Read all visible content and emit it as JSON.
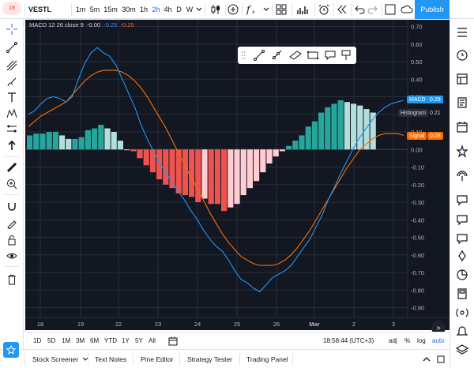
{
  "header": {
    "avatar_count": "18",
    "symbol": "VESTL",
    "intervals": [
      "1m",
      "5m",
      "15m",
      "30m",
      "1h",
      "2h",
      "4h",
      "D",
      "W"
    ],
    "active_interval": "2h",
    "publish_label": "Publish"
  },
  "chart": {
    "legend": {
      "name": "MACD 12 26 close 9",
      "histogram": "-0.00",
      "macd": "-0.25",
      "signal": "-0.25"
    },
    "tags": {
      "macd_name": "MACD",
      "macd_value": "0.28",
      "hist_name": "Histogram",
      "hist_value": "0.21",
      "signal_name": "Signal",
      "signal_value": "0.08"
    },
    "scroll_label": "»"
  },
  "chart_data": {
    "type": "line",
    "title": "MACD 12 26 close 9",
    "x_ticks": [
      "18",
      "19",
      "22",
      "23",
      "24",
      "25",
      "26",
      "Mar",
      "2",
      "3"
    ],
    "y_ticks": [
      "0.70",
      "0.60",
      "0.50",
      "0.40",
      "0.30",
      "0.20",
      "0.10",
      "0.00",
      "-0.10",
      "-0.20",
      "-0.30",
      "-0.40",
      "-0.50",
      "-0.60",
      "-0.70",
      "-0.80",
      "-0.90"
    ],
    "ylim": [
      -0.905,
      0.71
    ],
    "x_index_range": [
      0,
      60
    ],
    "colors": {
      "macd": "#2196f3",
      "signal": "#ff6d00",
      "hist_pos_strong": "#26a69a",
      "hist_pos_weak": "#b2dfdb",
      "hist_neg_strong": "#ef5350",
      "hist_neg_weak": "#ffcdd2",
      "grid": "#2a2e39",
      "axis_text": "#b2b5be"
    },
    "series": [
      {
        "name": "MACD",
        "x": [
          0,
          1,
          2,
          3,
          4,
          5,
          6,
          7,
          8,
          9,
          10,
          11,
          12,
          13,
          14,
          15,
          16,
          17,
          18,
          19,
          20,
          21,
          22,
          23,
          24,
          25,
          26,
          27,
          28,
          29,
          30,
          31,
          32,
          33,
          34,
          35,
          36,
          37,
          38,
          39,
          40,
          41,
          42,
          43,
          44,
          45,
          46,
          47,
          48,
          49,
          50,
          51,
          52,
          53,
          54,
          55,
          56,
          57,
          58,
          59,
          60
        ],
        "values": [
          0.2,
          0.22,
          0.26,
          0.29,
          0.3,
          0.29,
          0.27,
          0.3,
          0.4,
          0.49,
          0.55,
          0.58,
          0.55,
          0.53,
          0.48,
          0.4,
          0.32,
          0.24,
          0.14,
          0.06,
          -0.01,
          -0.08,
          -0.13,
          -0.19,
          -0.24,
          -0.29,
          -0.35,
          -0.4,
          -0.46,
          -0.51,
          -0.55,
          -0.58,
          -0.63,
          -0.69,
          -0.74,
          -0.76,
          -0.79,
          -0.81,
          -0.77,
          -0.73,
          -0.71,
          -0.69,
          -0.66,
          -0.61,
          -0.56,
          -0.51,
          -0.44,
          -0.37,
          -0.28,
          -0.21,
          -0.13,
          -0.06,
          0.01,
          0.07,
          0.12,
          0.17,
          0.21,
          0.24,
          0.26,
          0.27,
          0.28
        ]
      },
      {
        "name": "Signal",
        "x": [
          0,
          1,
          2,
          3,
          4,
          5,
          6,
          7,
          8,
          9,
          10,
          11,
          12,
          13,
          14,
          15,
          16,
          17,
          18,
          19,
          20,
          21,
          22,
          23,
          24,
          25,
          26,
          27,
          28,
          29,
          30,
          31,
          32,
          33,
          34,
          35,
          36,
          37,
          38,
          39,
          40,
          41,
          42,
          43,
          44,
          45,
          46,
          47,
          48,
          49,
          50,
          51,
          52,
          53,
          54,
          55,
          56,
          57,
          58,
          59,
          60
        ],
        "values": [
          0.13,
          0.16,
          0.19,
          0.21,
          0.23,
          0.25,
          0.27,
          0.31,
          0.35,
          0.39,
          0.42,
          0.44,
          0.45,
          0.45,
          0.45,
          0.44,
          0.42,
          0.39,
          0.35,
          0.3,
          0.24,
          0.18,
          0.12,
          0.05,
          -0.02,
          -0.09,
          -0.16,
          -0.22,
          -0.29,
          -0.36,
          -0.42,
          -0.48,
          -0.53,
          -0.57,
          -0.61,
          -0.63,
          -0.65,
          -0.66,
          -0.66,
          -0.66,
          -0.65,
          -0.63,
          -0.6,
          -0.56,
          -0.51,
          -0.46,
          -0.4,
          -0.34,
          -0.28,
          -0.22,
          -0.16,
          -0.1,
          -0.05,
          0.0,
          0.03,
          0.06,
          0.08,
          0.09,
          0.09,
          0.09,
          0.08
        ]
      },
      {
        "name": "Histogram",
        "x": [
          0,
          1,
          2,
          3,
          4,
          5,
          6,
          7,
          8,
          9,
          10,
          11,
          12,
          13,
          14,
          15,
          16,
          17,
          18,
          19,
          20,
          21,
          22,
          23,
          24,
          25,
          26,
          27,
          28,
          29,
          30,
          31,
          32,
          33,
          34,
          35,
          36,
          37,
          38,
          39,
          40,
          41,
          42,
          43,
          44,
          45,
          46,
          47,
          48,
          49,
          50,
          51,
          52,
          53,
          54,
          55,
          56,
          57,
          58,
          59,
          60
        ],
        "values": [
          0.07,
          0.06,
          0.07,
          0.08,
          0.07,
          0.04,
          0.0,
          -0.01,
          0.05,
          0.1,
          0.13,
          0.14,
          0.1,
          0.08,
          0.03,
          -0.04,
          -0.1,
          -0.15,
          -0.21,
          -0.24,
          -0.25,
          -0.26,
          -0.25,
          -0.24,
          -0.22,
          -0.2,
          -0.19,
          -0.18,
          -0.17,
          -0.15,
          -0.13,
          -0.1,
          -0.1,
          -0.12,
          -0.13,
          -0.13,
          -0.14,
          -0.15,
          -0.11,
          -0.07,
          -0.06,
          -0.06,
          -0.06,
          -0.05,
          -0.05,
          -0.05,
          -0.04,
          -0.03,
          0.0,
          0.01,
          0.03,
          0.04,
          0.06,
          0.07,
          0.09,
          0.11,
          0.13,
          0.15,
          0.17,
          0.18,
          0.2
        ],
        "hist_values": [
          0.08,
          0.09,
          0.09,
          0.1,
          0.1,
          0.08,
          0.06,
          0.06,
          0.07,
          0.11,
          0.12,
          0.14,
          0.12,
          0.1,
          0.05,
          0.0,
          -0.01,
          -0.05,
          -0.09,
          -0.13,
          -0.17,
          -0.2,
          -0.22,
          -0.25,
          -0.26,
          -0.27,
          -0.3,
          -0.28,
          -0.31,
          -0.31,
          -0.35,
          -0.33,
          -0.31,
          -0.26,
          -0.22,
          -0.18,
          -0.13,
          -0.08,
          -0.04,
          -0.01,
          0.02,
          0.05,
          0.08,
          0.13,
          0.16,
          0.21,
          0.24,
          0.26,
          0.28,
          0.27,
          0.26,
          0.25,
          0.23,
          0.21
        ]
      }
    ]
  },
  "range_bar": {
    "ranges": [
      "1D",
      "5D",
      "1M",
      "3M",
      "6M",
      "YTD",
      "1Y",
      "5Y",
      "All"
    ],
    "time": "18:58:44 (UTC+3)",
    "adj": "adj",
    "percent": "%",
    "log": "log",
    "auto": "auto"
  },
  "bottom_tabs": [
    "Stock Screener",
    "Text Notes",
    "Pine Editor",
    "Strategy Tester",
    "Trading Panel"
  ]
}
